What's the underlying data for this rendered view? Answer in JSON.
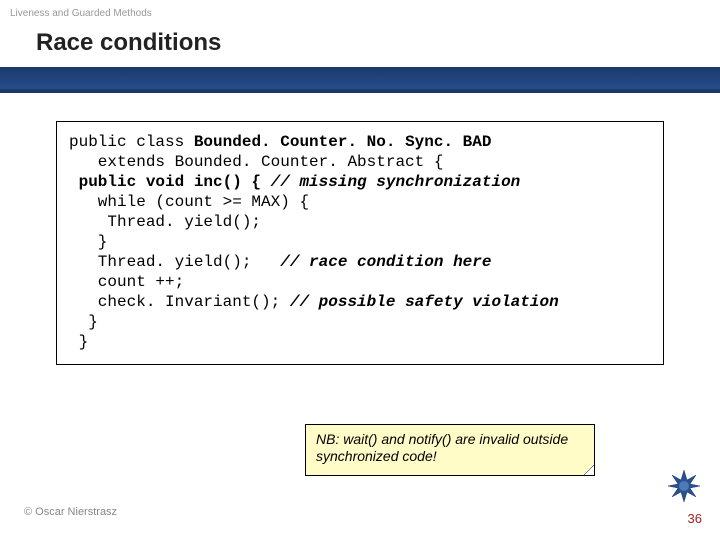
{
  "breadcrumb": "Liveness and Guarded Methods",
  "title": "Race conditions",
  "code": {
    "line1a": "public class ",
    "line1b": "Bounded. Counter. No. Sync. BAD",
    "line2": "   extends Bounded. Counter. Abstract {",
    "line3a": " public void inc() { ",
    "line3b": "// missing synchronization",
    "line4": "   while (count >= MAX) {",
    "line5": "    Thread. yield();",
    "line6": "   }",
    "line7a": "   Thread. yield();   ",
    "line7b": "// race condition here",
    "line8": "   count ++;",
    "line9a": "   check. Invariant(); ",
    "line9b": "// possible safety violation",
    "line10": "  }",
    "line11": " }"
  },
  "note": "NB: wait() and notify() are invalid outside synchronized code!",
  "copyright": "© Oscar Nierstrasz",
  "page_number": "36"
}
